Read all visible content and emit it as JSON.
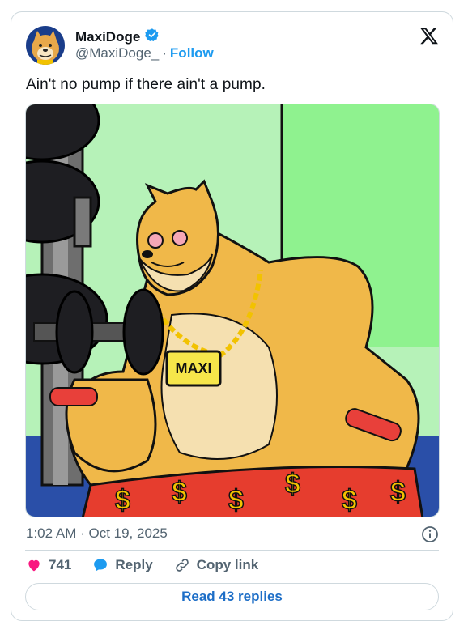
{
  "author": {
    "name": "MaxiDoge",
    "handle": "@MaxiDoge_",
    "separator": "·",
    "follow_label": "Follow"
  },
  "tweet": {
    "text": "Ain't no pump if there ain't a pump.",
    "timestamp": "1:02 AM · Oct 19, 2025",
    "image_text": "MAXI"
  },
  "actions": {
    "likes": "741",
    "reply_label": "Reply",
    "copy_link_label": "Copy link"
  },
  "read_replies_label": "Read 43 replies",
  "colors": {
    "accent": "#1d9bf0",
    "like": "#f91880",
    "verified": "#1d9bf0",
    "link_button": "#1d6ec7"
  }
}
